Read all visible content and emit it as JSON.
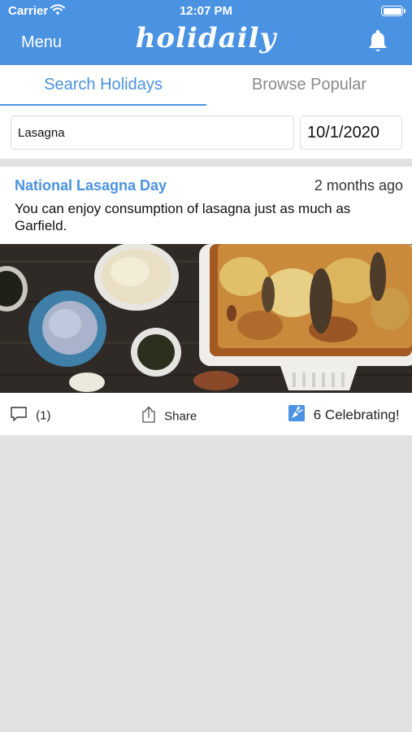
{
  "status": {
    "carrier": "Carrier",
    "time": "12:07 PM"
  },
  "header": {
    "menu_label": "Menu",
    "logo_text": "holidaily"
  },
  "tabs": [
    {
      "label": "Search Holidays",
      "active": true
    },
    {
      "label": "Browse Popular",
      "active": false
    }
  ],
  "search": {
    "query": "Lasagna",
    "date": "10/1/2020"
  },
  "holiday": {
    "title": "National Lasagna Day",
    "time_ago": "2 months ago",
    "description": "You can enjoy consumption of lasagna just as much as Garfield.",
    "comment_count": "(1)",
    "share_label": "Share",
    "celebrating_label": "6 Celebrating!"
  },
  "colors": {
    "accent": "#4a92e2",
    "background": "#e2e2e2"
  }
}
